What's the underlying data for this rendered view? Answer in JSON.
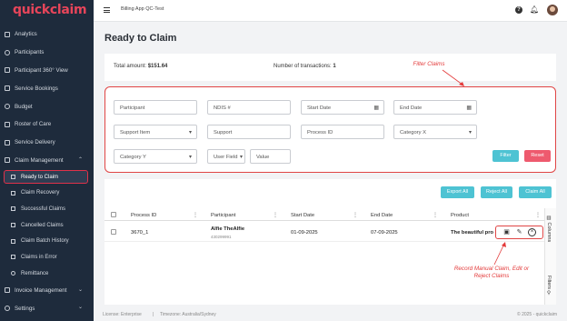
{
  "brand": "quickclaim",
  "environment": "Billing App QC-Test",
  "sidebar": {
    "items": [
      {
        "label": "Analytics"
      },
      {
        "label": "Participants"
      },
      {
        "label": "Participant 360° View"
      },
      {
        "label": "Service Bookings"
      },
      {
        "label": "Budget"
      },
      {
        "label": "Roster of Care"
      },
      {
        "label": "Service Delivery"
      },
      {
        "label": "Claim Management"
      }
    ],
    "claim_submenu": [
      {
        "label": "Ready to Claim"
      },
      {
        "label": "Claim Recovery"
      },
      {
        "label": "Successful Claims"
      },
      {
        "label": "Cancelled Claims"
      },
      {
        "label": "Claim Batch History"
      },
      {
        "label": "Claims in Error"
      },
      {
        "label": "Remittance"
      }
    ],
    "bottom": [
      {
        "label": "Invoice Management"
      },
      {
        "label": "Settings"
      }
    ]
  },
  "page": {
    "title": "Ready to Claim"
  },
  "summary": {
    "total_label": "Total amount:",
    "total_value": "$151.64",
    "count_label": "Number of transactions:",
    "count_value": "1"
  },
  "annotations": {
    "filter": "Filter Claims",
    "record": "Record Manual Claim, Edit or Reject Claims"
  },
  "filters": {
    "participant": "Participant",
    "ndis": "NDIS #",
    "start_date": "Start Date",
    "end_date": "End Date",
    "support_item": "Support Item",
    "support": "Support",
    "process_id": "Process ID",
    "category_x": "Category X",
    "category_y": "Category Y",
    "user_field": "User Field",
    "value": "Value",
    "filter_btn": "Filter",
    "reset_btn": "Reset"
  },
  "grid_actions": {
    "export_all": "Export All",
    "reject_all": "Reject All",
    "claim_all": "Claim All"
  },
  "table": {
    "headers": [
      "Process ID",
      "Participant",
      "Start Date",
      "End Date",
      "Product"
    ],
    "rows": [
      {
        "process_id": "3670_1",
        "participant": "Alfie TheAlfie",
        "participant_sub": "430299991",
        "start_date": "01-09-2025",
        "end_date": "07-09-2025",
        "product": "The beautiful pro"
      }
    ],
    "side_tabs": [
      "Columns",
      "Filters"
    ]
  },
  "footer": {
    "license": "License: Enterprise",
    "timezone": "Timezone: Australia/Sydney",
    "copyright": "© 2025 - quickclaim"
  },
  "colors": {
    "sidebar_bg": "#1e2b3c",
    "brand": "#e8455a",
    "teal": "#4ec3d3",
    "reset": "#ee5a6e",
    "annotation": "#e33a3a"
  }
}
